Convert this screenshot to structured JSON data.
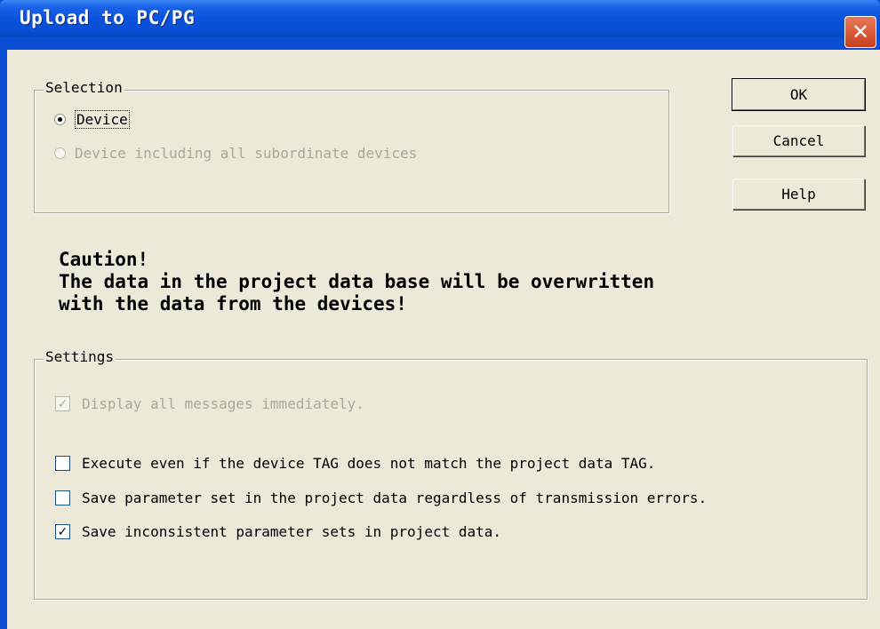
{
  "window": {
    "title": "Upload to PC/PG",
    "close_label": "✕"
  },
  "selection": {
    "legend": "Selection",
    "options": [
      {
        "label": "Device",
        "checked": true,
        "enabled": true
      },
      {
        "label": "Device including all subordinate devices",
        "checked": false,
        "enabled": false
      }
    ]
  },
  "buttons": {
    "ok": "OK",
    "cancel": "Cancel",
    "help": "Help"
  },
  "caution": {
    "line1": "Caution!",
    "line2": "The data in the project data base will be overwritten",
    "line3": "with the data from the devices!"
  },
  "settings": {
    "legend": "Settings",
    "options": [
      {
        "label": "Display all messages immediately.",
        "checked": true,
        "enabled": false
      },
      {
        "label": "Execute even if the device TAG does not match the project data TAG.",
        "checked": false,
        "enabled": true
      },
      {
        "label": "Save parameter set in the project data regardless of transmission errors.",
        "checked": false,
        "enabled": true
      },
      {
        "label": "Save inconsistent parameter sets in project data.",
        "checked": true,
        "enabled": true
      }
    ]
  }
}
